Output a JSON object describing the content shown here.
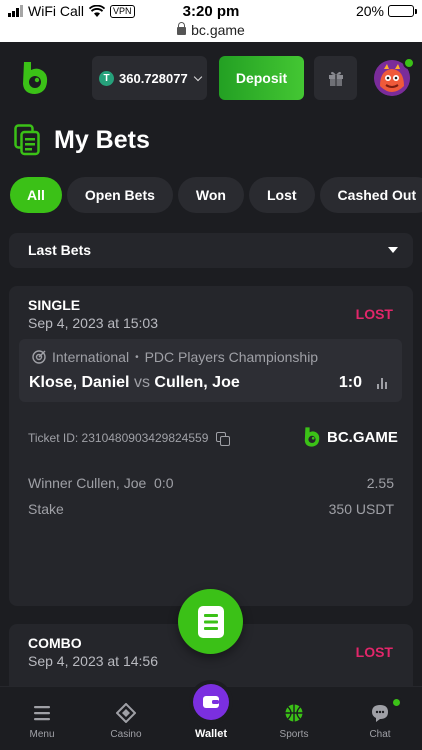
{
  "status_bar": {
    "carrier": "WiFi Call",
    "vpn": "VPN",
    "time": "3:20 pm",
    "battery": "20%",
    "battery_level": 0.2
  },
  "browser": {
    "url": "bc.game"
  },
  "header": {
    "balance": "360.728077",
    "currency_icon": "tether-icon",
    "deposit_label": "Deposit"
  },
  "page": {
    "title": "My Bets"
  },
  "filters": {
    "tabs": [
      {
        "label": "All",
        "active": true
      },
      {
        "label": "Open Bets",
        "active": false
      },
      {
        "label": "Won",
        "active": false
      },
      {
        "label": "Lost",
        "active": false
      },
      {
        "label": "Cashed Out",
        "active": false
      }
    ]
  },
  "dropdown": {
    "selected": "Last Bets"
  },
  "bets": [
    {
      "type": "SINGLE",
      "date": "Sep 4, 2023 at 15:03",
      "status": "LOST",
      "league": "International",
      "tournament": "PDC Players Championship",
      "home": "Klose, Daniel",
      "vs": "vs",
      "away": "Cullen, Joe",
      "score": "1:0",
      "ticket_id": "Ticket ID: 2310480903429824559",
      "brand": "BC.GAME",
      "selection": "Winner Cullen, Joe  0:0",
      "odds": "2.55",
      "stake_label": "Stake",
      "stake_value": "350 USDT"
    },
    {
      "type": "COMBO",
      "date": "Sep 4, 2023 at 14:56",
      "status": "LOST"
    }
  ],
  "bottom_nav": {
    "menu": "Menu",
    "casino": "Casino",
    "wallet": "Wallet",
    "sports": "Sports",
    "chat": "Chat"
  },
  "colors": {
    "accent": "#3bc117",
    "lost": "#e2266a",
    "background": "#1c1d21",
    "card": "#25262b",
    "wallet": "#7b2fe0"
  }
}
